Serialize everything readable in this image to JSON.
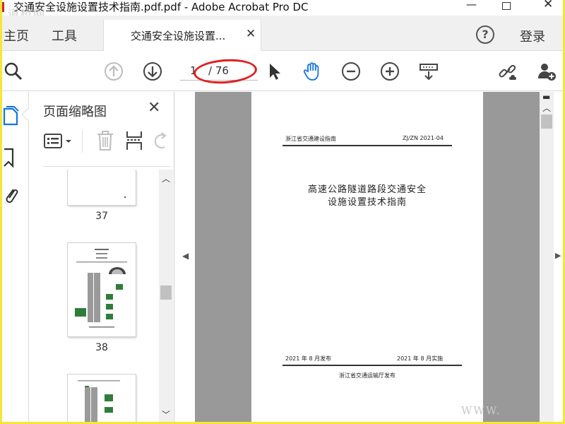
{
  "window": {
    "title": "交通安全设施设置技术指南.pdf.pdf - Adobe Acrobat Pro DC",
    "minimize": "—",
    "close": "✕",
    "watermark": "道桥网"
  },
  "tabs": {
    "home": "主页",
    "tools": "工具",
    "document": "交通安全设施设置...",
    "document_close": "✕"
  },
  "header": {
    "help": "?",
    "login": "登录"
  },
  "toolbar": {
    "page_current": "1",
    "page_total": "/ 76",
    "accent": "#1473e6",
    "annotation_color": "#e02020"
  },
  "thumbnails_panel": {
    "title": "页面缩略图",
    "close": "✕",
    "pages": [
      {
        "number": "37"
      },
      {
        "number": "38"
      }
    ]
  },
  "page": {
    "header_left": "浙江省交通建设指南",
    "header_right": "ZJ/ZN 2021-04",
    "title_line1": "高速公路隧道路段交通安全",
    "title_line2": "设施设置技术指南",
    "publish_date": "2021 年 8 月发布",
    "effective_date": "2021 年 8 月实施",
    "issuer": "浙江省交通运输厅发布"
  },
  "footer": {
    "watermark": "WWW."
  }
}
